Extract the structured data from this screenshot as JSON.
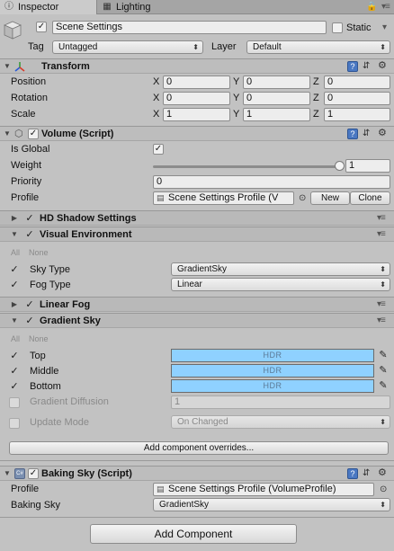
{
  "tabs": [
    {
      "label": "Inspector",
      "icon": "info-icon"
    },
    {
      "label": "Lighting",
      "icon": "grid-icon"
    }
  ],
  "object": {
    "name": "Scene Settings",
    "static_label": "Static",
    "tag_label": "Tag",
    "tag_value": "Untagged",
    "layer_label": "Layer",
    "layer_value": "Default"
  },
  "transform": {
    "title": "Transform",
    "rows": [
      {
        "label": "Position",
        "x": "0",
        "y": "0",
        "z": "0"
      },
      {
        "label": "Rotation",
        "x": "0",
        "y": "0",
        "z": "0"
      },
      {
        "label": "Scale",
        "x": "1",
        "y": "1",
        "z": "1"
      }
    ],
    "axes": [
      "X",
      "Y",
      "Z"
    ]
  },
  "volume": {
    "title": "Volume (Script)",
    "is_global_label": "Is Global",
    "weight_label": "Weight",
    "weight_value": "1",
    "weight_fraction": 1.0,
    "priority_label": "Priority",
    "priority_value": "0",
    "profile_label": "Profile",
    "profile_value": "Scene Settings Profile (V",
    "new_label": "New",
    "clone_label": "Clone"
  },
  "hd_shadow": {
    "title": "HD Shadow Settings"
  },
  "visual_env": {
    "title": "Visual Environment",
    "all_label": "All",
    "none_label": "None",
    "sky_type_label": "Sky Type",
    "sky_type_value": "GradientSky",
    "fog_type_label": "Fog Type",
    "fog_type_value": "Linear"
  },
  "linear_fog": {
    "title": "Linear Fog"
  },
  "gradient_sky": {
    "title": "Gradient Sky",
    "all_label": "All",
    "none_label": "None",
    "top_label": "Top",
    "middle_label": "Middle",
    "bottom_label": "Bottom",
    "hdr_label": "HDR",
    "diffusion_label": "Gradient Diffusion",
    "diffusion_value": "1",
    "update_mode_label": "Update Mode",
    "update_mode_value": "On Changed",
    "color": "#8fd1ff"
  },
  "add_overrides_label": "Add component overrides...",
  "baking_sky": {
    "title": "Baking Sky (Script)",
    "profile_label": "Profile",
    "profile_value": "Scene Settings Profile (VolumeProfile)",
    "baking_sky_label": "Baking Sky",
    "baking_sky_value": "GradientSky"
  },
  "add_component_label": "Add Component"
}
